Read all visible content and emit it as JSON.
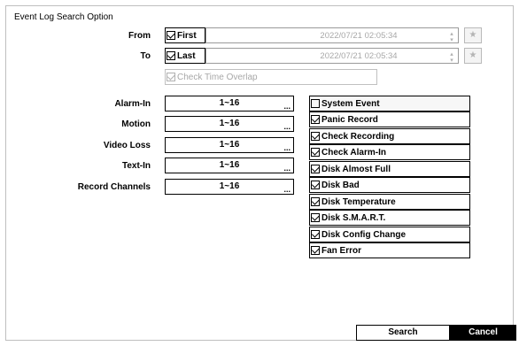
{
  "window": {
    "title": "Event Log Search Option"
  },
  "from": {
    "label": "From",
    "checkbox_label": "First",
    "checked": true,
    "datetime": "2022/07/21  02:05:34"
  },
  "to": {
    "label": "To",
    "checkbox_label": "Last",
    "checked": true,
    "datetime": "2022/07/21  02:05:34"
  },
  "overlap": {
    "label": "Check Time Overlap",
    "checked": true,
    "disabled": true
  },
  "filters": [
    {
      "label": "Alarm-In",
      "value": "1~16"
    },
    {
      "label": "Motion",
      "value": "1~16"
    },
    {
      "label": "Video Loss",
      "value": "1~16"
    },
    {
      "label": "Text-In",
      "value": "1~16"
    },
    {
      "label": "Record Channels",
      "value": "1~16"
    }
  ],
  "events": [
    {
      "label": "System Event",
      "checked": false
    },
    {
      "label": "Panic Record",
      "checked": true
    },
    {
      "label": "Check Recording",
      "checked": true
    },
    {
      "label": "Check Alarm-In",
      "checked": true
    },
    {
      "label": "Disk Almost Full",
      "checked": true
    },
    {
      "label": "Disk Bad",
      "checked": true
    },
    {
      "label": "Disk Temperature",
      "checked": true
    },
    {
      "label": "Disk S.M.A.R.T.",
      "checked": true
    },
    {
      "label": "Disk Config Change",
      "checked": true
    },
    {
      "label": "Fan Error",
      "checked": true
    }
  ],
  "buttons": {
    "search": "Search",
    "cancel": "Cancel"
  },
  "icons": {
    "favorite": "star-icon",
    "spinner": "up-down-spinner-icon",
    "more": "ellipsis-icon"
  },
  "colors": {
    "cancel_bg": "#000000",
    "disabled_text": "#a8a8a8"
  }
}
